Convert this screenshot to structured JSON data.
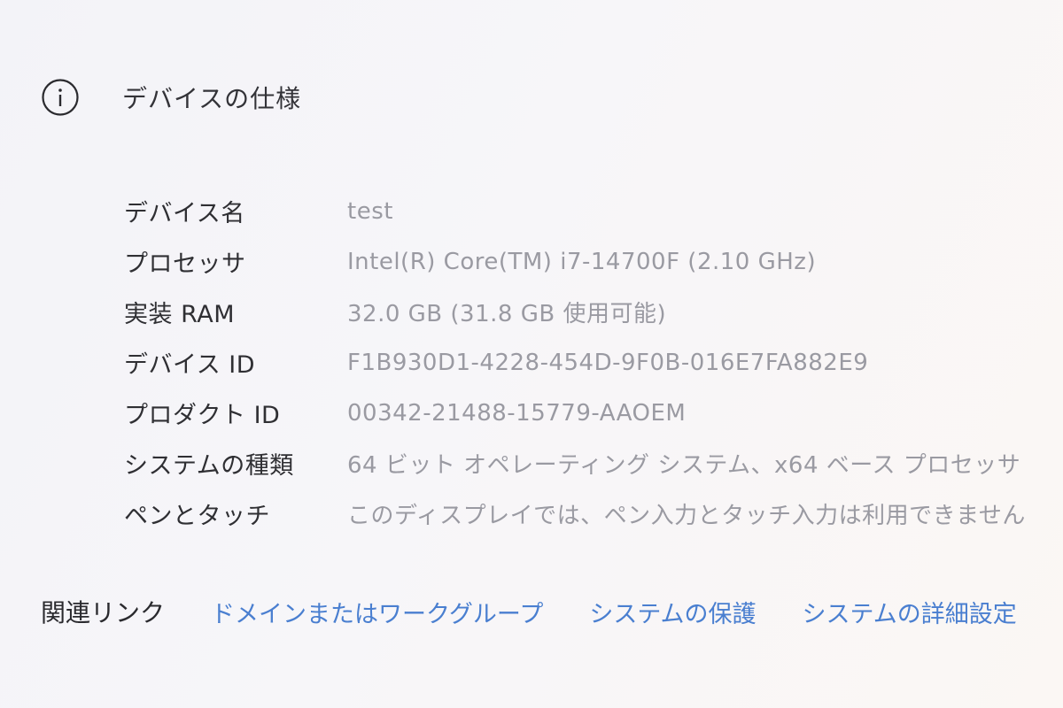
{
  "section": {
    "icon": "info-circle-icon",
    "title": "デバイスの仕様"
  },
  "specs": [
    {
      "label": "デバイス名",
      "value": "test"
    },
    {
      "label": "プロセッサ",
      "value": "Intel(R) Core(TM) i7-14700F (2.10 GHz)"
    },
    {
      "label": "実装 RAM",
      "value": "32.0 GB (31.8 GB 使用可能)"
    },
    {
      "label": "デバイス ID",
      "value": "F1B930D1-4228-454D-9F0B-016E7FA882E9"
    },
    {
      "label": "プロダクト ID",
      "value": "00342-21488-15779-AAOEM"
    },
    {
      "label": "システムの種類",
      "value": "64 ビット オペレーティング システム、x64 ベース プロセッサ"
    },
    {
      "label": "ペンとタッチ",
      "value": "このディスプレイでは、ペン入力とタッチ入力は利用できません"
    }
  ],
  "related": {
    "label": "関連リンク",
    "links": [
      "ドメインまたはワークグループ",
      "システムの保護",
      "システムの詳細設定"
    ]
  },
  "colors": {
    "link": "#4a7fd0",
    "value_text": "#9a9aa2",
    "label_text": "#2f2f33"
  }
}
